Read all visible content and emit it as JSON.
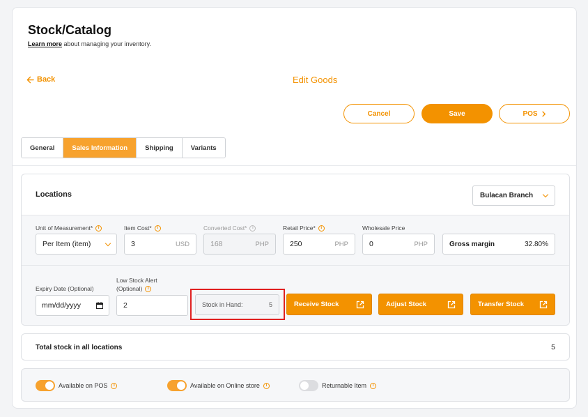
{
  "header": {
    "title": "Stock/Catalog",
    "learn_more": "Learn more",
    "subtitle_rest": " about managing your inventory."
  },
  "nav": {
    "back_label": "Back",
    "page_heading": "Edit Goods"
  },
  "actions": {
    "cancel": "Cancel",
    "save": "Save",
    "pos": "POS"
  },
  "tabs": [
    "General",
    "Sales Information",
    "Shipping",
    "Variants"
  ],
  "active_tab": "Sales Information",
  "locations": {
    "title": "Locations",
    "branch": "Bulacan Branch",
    "fields": {
      "uom_label": "Unit of Measurement*",
      "uom_value": "Per Item (item)",
      "item_cost_label": "Item Cost*",
      "item_cost_value": "3",
      "item_cost_unit": "USD",
      "converted_cost_label": "Converted Cost*",
      "converted_cost_value": "168",
      "converted_cost_unit": "PHP",
      "retail_price_label": "Retail Price*",
      "retail_price_value": "250",
      "retail_price_unit": "PHP",
      "wholesale_label": "Wholesale Price",
      "wholesale_value": "0",
      "wholesale_unit": "PHP",
      "gross_margin_label": "Gross margin",
      "gross_margin_value": "32.80%"
    },
    "expiry_label": "Expiry Date (Optional)",
    "expiry_placeholder": "mm/dd/yyyy",
    "low_stock_label_1": "Low Stock Alert",
    "low_stock_label_2": "(Optional)",
    "low_stock_value": "2",
    "stock_in_hand_label": "Stock in Hand:",
    "stock_in_hand_value": "5",
    "receive_stock": "Receive Stock",
    "adjust_stock": "Adjust Stock",
    "transfer_stock": "Transfer Stock"
  },
  "total": {
    "label": "Total stock in all locations",
    "value": "5"
  },
  "toggles": [
    {
      "label": "Available on POS",
      "on": true
    },
    {
      "label": "Available on Online store",
      "on": true
    },
    {
      "label": "Returnable Item",
      "on": false
    }
  ],
  "colors": {
    "accent": "#f39200",
    "highlight_box": "#e02020"
  }
}
